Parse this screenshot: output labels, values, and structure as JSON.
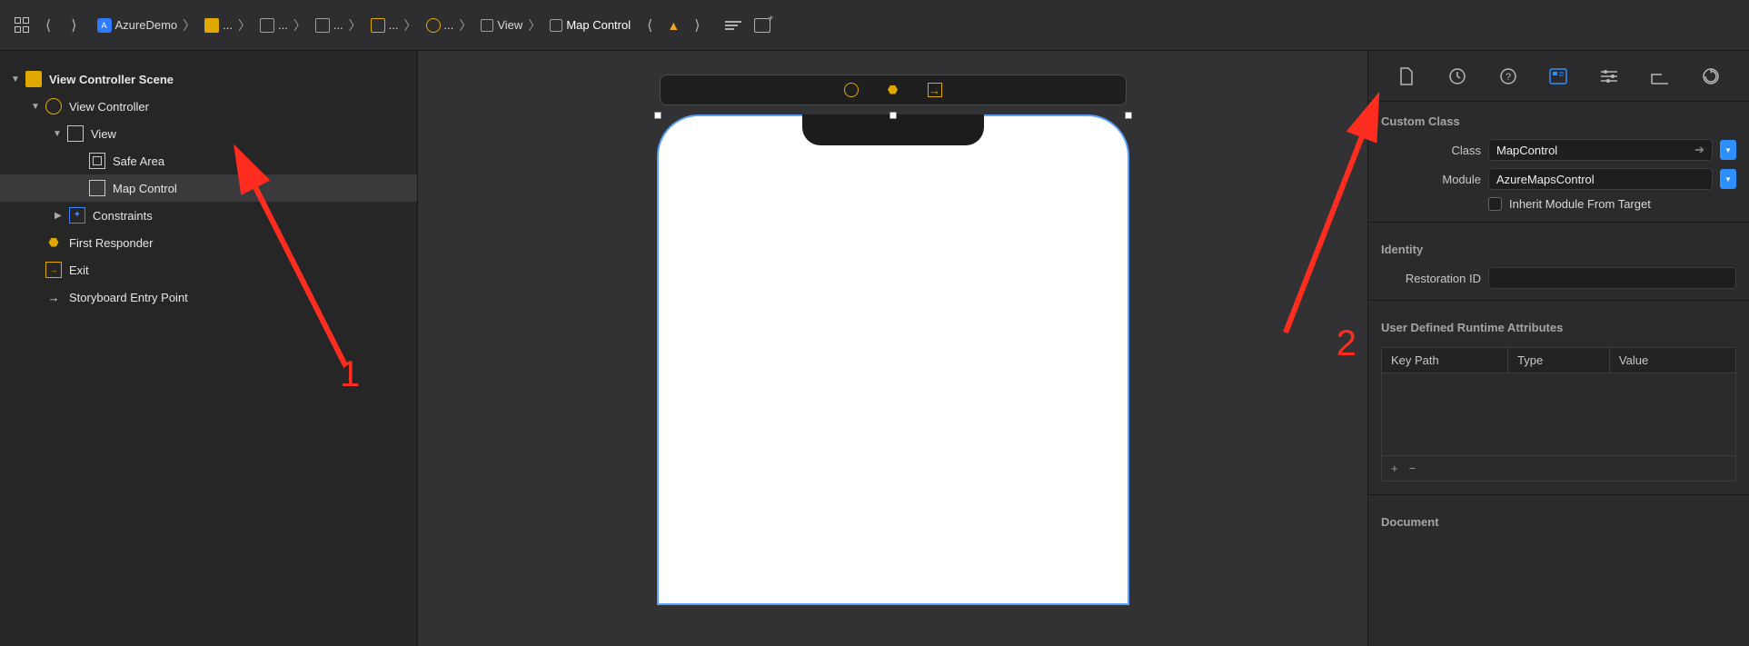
{
  "toolbar": {
    "project": "AzureDemo",
    "crumbs": [
      {
        "label": "...",
        "icon": "folder"
      },
      {
        "label": "...",
        "icon": "storyboard-grey"
      },
      {
        "label": "...",
        "icon": "storyboard-grey"
      },
      {
        "label": "...",
        "icon": "storyboard-yellow"
      },
      {
        "label": "...",
        "icon": "circle-yellow"
      },
      {
        "label": "View",
        "icon": "square-grey"
      },
      {
        "label": "Map Control",
        "icon": "square-grey"
      }
    ]
  },
  "outline": {
    "scene": "View Controller Scene",
    "vc": "View Controller",
    "view": "View",
    "safe": "Safe Area",
    "map": "Map Control",
    "constraints": "Constraints",
    "first": "First Responder",
    "exit": "Exit",
    "entry": "Storyboard Entry Point"
  },
  "inspector": {
    "custom_class_title": "Custom Class",
    "class_label": "Class",
    "class_value": "MapControl",
    "module_label": "Module",
    "module_value": "AzureMapsControl",
    "inherit_label": "Inherit Module From Target",
    "identity_title": "Identity",
    "restoration_label": "Restoration ID",
    "restoration_value": "",
    "udra_title": "User Defined Runtime Attributes",
    "columns": {
      "key": "Key Path",
      "type": "Type",
      "value": "Value"
    },
    "document_title": "Document"
  },
  "annotations": {
    "one": "1",
    "two": "2"
  }
}
